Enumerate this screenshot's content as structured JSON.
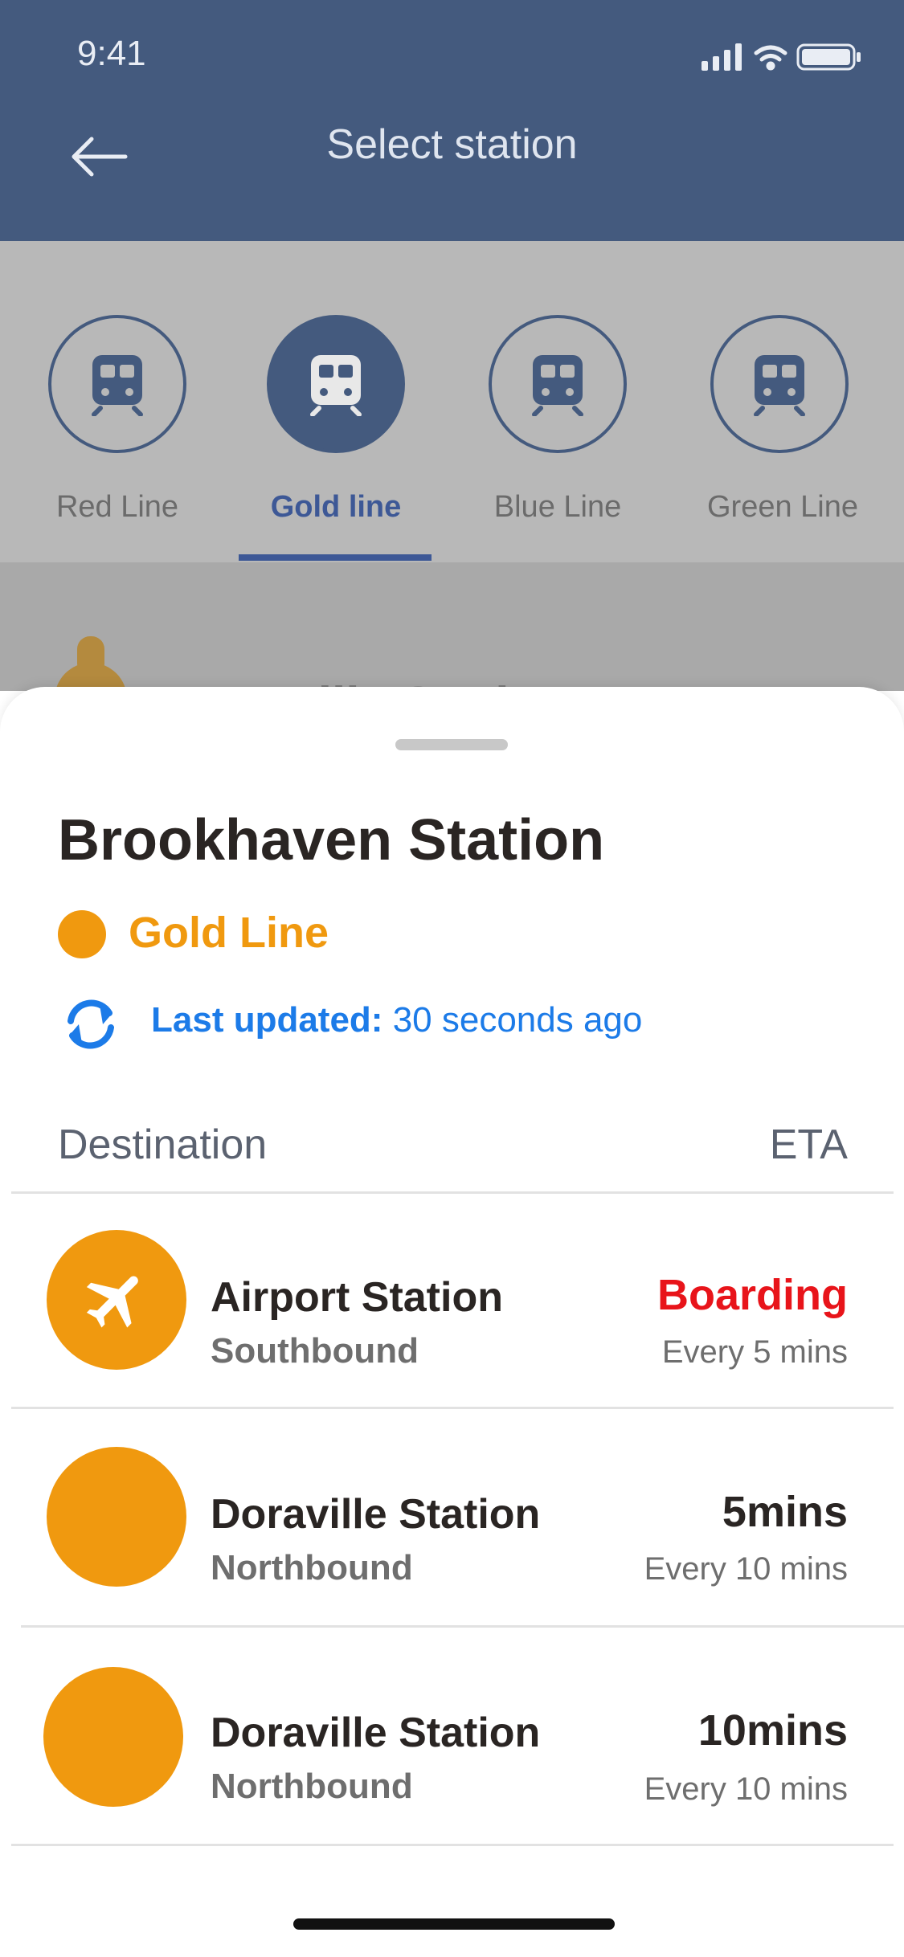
{
  "status_bar": {
    "time": "9:41"
  },
  "header": {
    "title": "Select station"
  },
  "lines": [
    {
      "label": "Red Line",
      "active": false
    },
    {
      "label": "Gold line",
      "active": true
    },
    {
      "label": "Blue Line",
      "active": false
    },
    {
      "label": "Green Line",
      "active": false
    }
  ],
  "background_preview": {
    "text": "Doraville Station"
  },
  "sheet": {
    "station_name": "Brookhaven Station",
    "line_name": "Gold Line",
    "last_updated_label": "Last updated:",
    "last_updated_value": "30 seconds ago",
    "columns": {
      "destination": "Destination",
      "eta": "ETA"
    },
    "rows": [
      {
        "title": "Airport Station",
        "direction": "Southbound",
        "eta": "Boarding",
        "frequency": "Every 5 mins",
        "icon": "airplane-icon"
      },
      {
        "title": "Doraville Station",
        "direction": "Northbound",
        "eta": "5mins",
        "frequency": "Every 10 mins",
        "icon": ""
      },
      {
        "title": "Doraville Station",
        "direction": "Northbound",
        "eta": "10mins",
        "frequency": "Every 10 mins",
        "icon": ""
      }
    ]
  },
  "colors": {
    "header_bg": "#445a7e",
    "gold": "#f0990f",
    "boarding_red": "#e8141a",
    "link_blue": "#1c7be8"
  }
}
